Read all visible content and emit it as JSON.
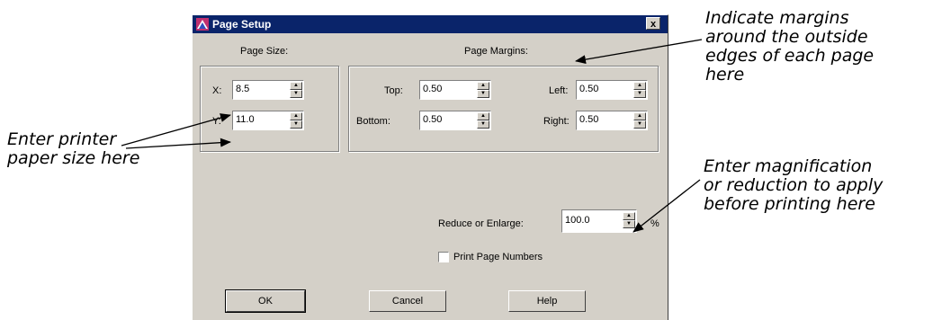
{
  "dialog": {
    "title": "Page Setup",
    "close_glyph": "x",
    "page_size_label": "Page Size:",
    "page_margins_label": "Page Margins:",
    "x_label": "X:",
    "y_label": "Y:",
    "x_value": "8.5",
    "y_value": "11.0",
    "top_label": "Top:",
    "bottom_label": "Bottom:",
    "left_label": "Left:",
    "right_label": "Right:",
    "top_value": "0.50",
    "bottom_value": "0.50",
    "left_value": "0.50",
    "right_value": "0.50",
    "reduce_label": "Reduce or Enlarge:",
    "reduce_value": "100.0",
    "percent": "%",
    "print_page_numbers_label": "Print Page Numbers",
    "print_page_numbers_checked": false,
    "ok_label": "OK",
    "cancel_label": "Cancel",
    "help_label": "Help",
    "spin_up_glyph": "▲",
    "spin_down_glyph": "▼"
  },
  "annotations": {
    "margins_line1": "Indicate margins",
    "margins_line2": "around the outside",
    "margins_line3": "edges of each page",
    "margins_line4": "here",
    "paper_line1": "Enter printer",
    "paper_line2": "paper size here",
    "mag_line1": "Enter magnification",
    "mag_line2": "or reduction to apply",
    "mag_line3": "before printing here"
  },
  "colors": {
    "dialog_bg": "#d4d0c8",
    "titlebar": "#0a246a",
    "field_bg": "#ffffff"
  }
}
